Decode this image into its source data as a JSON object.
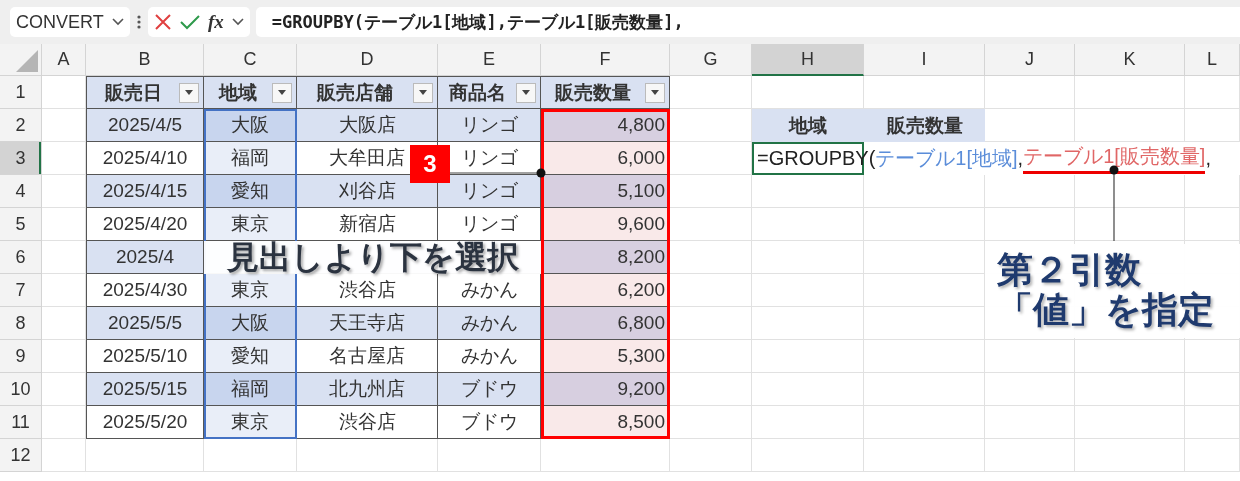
{
  "formula_bar": {
    "name_box": "CONVERT",
    "function_label": "fx",
    "formula": "=GROUPBY(テーブル1[地域],テーブル1[販売数量],"
  },
  "column_headers": [
    {
      "label": "A",
      "selected": false
    },
    {
      "label": "B",
      "selected": false
    },
    {
      "label": "C",
      "selected": false
    },
    {
      "label": "D",
      "selected": false
    },
    {
      "label": "E",
      "selected": false
    },
    {
      "label": "F",
      "selected": false
    },
    {
      "label": "G",
      "selected": false
    },
    {
      "label": "H",
      "selected": true
    },
    {
      "label": "I",
      "selected": false
    },
    {
      "label": "J",
      "selected": false
    },
    {
      "label": "K",
      "selected": false
    },
    {
      "label": "L",
      "selected": false
    }
  ],
  "row_headers": [
    {
      "label": "1",
      "selected": false
    },
    {
      "label": "2",
      "selected": false
    },
    {
      "label": "3",
      "selected": true
    },
    {
      "label": "4",
      "selected": false
    },
    {
      "label": "5",
      "selected": false
    },
    {
      "label": "6",
      "selected": false
    },
    {
      "label": "7",
      "selected": false
    },
    {
      "label": "8",
      "selected": false
    },
    {
      "label": "9",
      "selected": false
    },
    {
      "label": "10",
      "selected": false
    },
    {
      "label": "11",
      "selected": false
    },
    {
      "label": "12",
      "selected": false
    }
  ],
  "table": {
    "columns": [
      {
        "header": "販売日",
        "kind": "date",
        "selected": false
      },
      {
        "header": "地域",
        "kind": "text",
        "selected": true,
        "color": "#4472c4"
      },
      {
        "header": "販売店舗",
        "kind": "text",
        "selected": false
      },
      {
        "header": "商品名",
        "kind": "text",
        "selected": false
      },
      {
        "header": "販売数量",
        "kind": "number",
        "selected": true,
        "color": "#ff0000"
      }
    ],
    "rows": [
      [
        "2025/4/5",
        "大阪",
        "大阪店",
        "リンゴ",
        "4,800"
      ],
      [
        "2025/4/10",
        "福岡",
        "大牟田店",
        "リンゴ",
        "6,000"
      ],
      [
        "2025/4/15",
        "愛知",
        "刈谷店",
        "リンゴ",
        "5,100"
      ],
      [
        "2025/4/20",
        "東京",
        "新宿店",
        "リンゴ",
        "9,600"
      ],
      [
        "2025/4",
        null,
        null,
        null,
        "8,200"
      ],
      [
        "2025/4/30",
        "東京",
        "渋谷店",
        "みかん",
        "6,200"
      ],
      [
        "2025/5/5",
        "大阪",
        "天王寺店",
        "みかん",
        "6,800"
      ],
      [
        "2025/5/10",
        "愛知",
        "名古屋店",
        "みかん",
        "5,300"
      ],
      [
        "2025/5/15",
        "福岡",
        "北九州店",
        "ブドウ",
        "9,200"
      ],
      [
        "2025/5/20",
        "東京",
        "渋谷店",
        "ブドウ",
        "8,500"
      ]
    ]
  },
  "result": {
    "headers": [
      "地域",
      "販売数量"
    ],
    "formula_parts": [
      {
        "kind": "plain",
        "text": "=GROUPBY(",
        "emphasized": false
      },
      {
        "kind": "ref1",
        "text": "テーブル1[地域]",
        "emphasized": false
      },
      {
        "kind": "plain",
        "text": ",",
        "emphasized": false
      },
      {
        "kind": "ref2",
        "text": "テーブル1[販売数量]",
        "emphasized": true
      },
      {
        "kind": "plain",
        "text": ",",
        "emphasized": false
      }
    ]
  },
  "annotations": {
    "step_badge": "3",
    "callout_select": "見出しより下を選択",
    "callout_value": [
      "第２引数",
      "「値」を指定"
    ]
  }
}
